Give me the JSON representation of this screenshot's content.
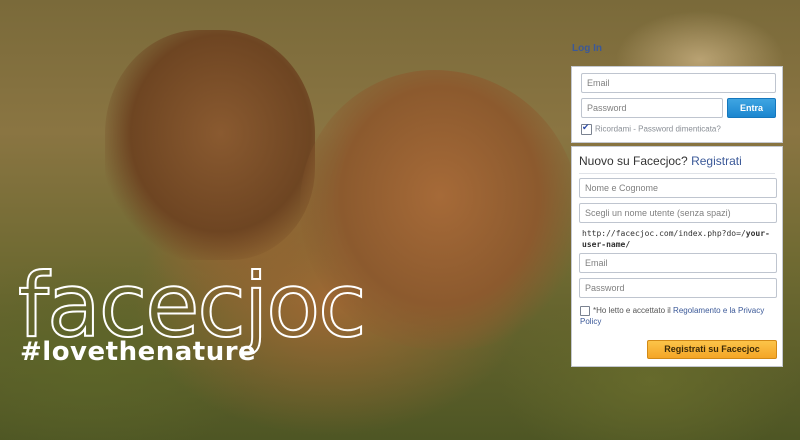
{
  "brand": {
    "logo_text": "facecjoc",
    "tagline": "#lovethenature"
  },
  "login": {
    "title": "Log In",
    "email_placeholder": "Email",
    "password_placeholder": "Password",
    "submit_label": "Entra",
    "remember_label": "Ricordami",
    "separator": " - ",
    "forgot_label": "Password dimenticata?"
  },
  "register": {
    "title_prefix": "Nuovo su Facecjoc?",
    "title_link": "Registrati",
    "name_placeholder": "Nome e Cognome",
    "username_placeholder": "Scegli un nome utente (senza spazi)",
    "url_prefix": "http://facecjoc.com/index.php?do=/",
    "url_suffix": "your-user-name/",
    "email_placeholder": "Email",
    "password_placeholder": "Password",
    "terms_prefix": "*Ho letto e accettato il ",
    "terms_link": "Regolamento e la Privacy Policy",
    "submit_label": "Registrati su Facecjoc"
  },
  "colors": {
    "link": "#3b5998",
    "login_button": "#1b86cf",
    "register_button": "#f4a526"
  }
}
